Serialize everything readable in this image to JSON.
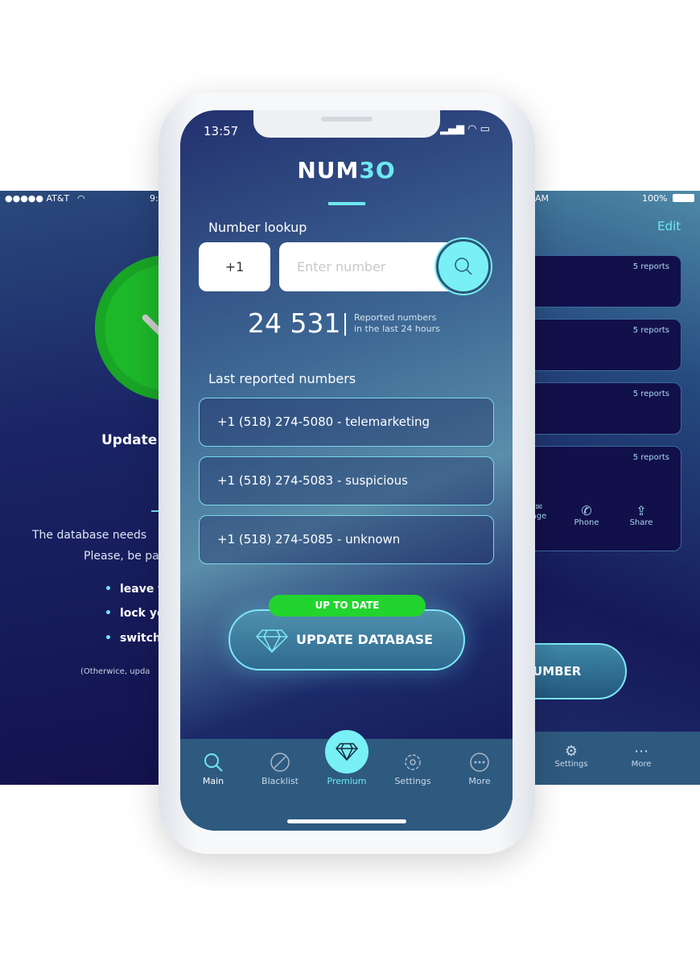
{
  "left_screen": {
    "carrier": "●●●●● AT&T",
    "time_partial": "9:",
    "title_partial": "Update",
    "line1": "The database needs",
    "line2": "Please, be pa",
    "bullets": [
      "leave t",
      "lock yo",
      "switch"
    ],
    "note": "(Otherwice, upda"
  },
  "right_screen": {
    "time_partial": "AM",
    "battery": "100%",
    "edit": "Edit",
    "cards": [
      "5 reports",
      "5 reports",
      "5 reports",
      "5 reports"
    ],
    "actions": [
      "age",
      "Phone",
      "Share"
    ],
    "button": "UMBER",
    "tabs": [
      "Settings",
      "More"
    ]
  },
  "main": {
    "time": "13:57",
    "logo_main": "NUM",
    "logo_accent": "3O",
    "lookup_label": "Number lookup",
    "country_code": "+1",
    "number_placeholder": "Enter number",
    "stat_value": "24 531",
    "stat_label_1": "Reported numbers",
    "stat_label_2": "in the last 24 hours",
    "last_label": "Last reported numbers",
    "reports": [
      "+1 (518) 274-5080  -  telemarketing",
      "+1 (518) 274-5083  -  suspicious",
      "+1 (518) 274-5085  -  unknown"
    ],
    "status_badge": "UP TO DATE",
    "update_button": "UPDATE DATABASE",
    "tabs": [
      {
        "label": "Main",
        "icon": "search-icon"
      },
      {
        "label": "Blacklist",
        "icon": "block-icon"
      },
      {
        "label": "Premium",
        "icon": "diamond-icon"
      },
      {
        "label": "Settings",
        "icon": "gear-icon"
      },
      {
        "label": "More",
        "icon": "more-icon"
      }
    ],
    "colors": {
      "accent": "#6ee8f0",
      "status_green": "#22d42e",
      "tab_bar": "#2e5a80"
    }
  }
}
